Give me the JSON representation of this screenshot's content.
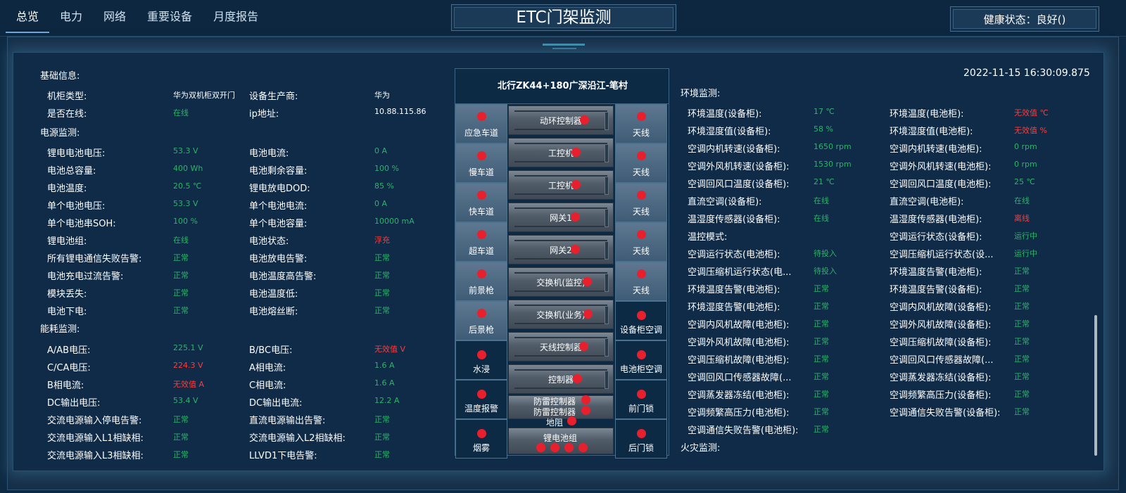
{
  "nav": {
    "tabs": [
      "总览",
      "电力",
      "网络",
      "重要设备",
      "月度报告"
    ]
  },
  "header": {
    "title": "ETC门架监测",
    "health": "健康状态：良好()"
  },
  "datetime": "2022-11-15 16:30:09.875",
  "left": {
    "basic_title": "基础信息:",
    "basic": [
      {
        "l1": "机柜类型:",
        "v1": "华为双机柜双开门",
        "c1": "w",
        "l2": "设备生产商:",
        "v2": "华为",
        "c2": "w"
      },
      {
        "l1": "是否在线:",
        "v1": "在线",
        "c1": "g",
        "l2": "ip地址:",
        "v2": "10.88.115.86",
        "c2": "w"
      }
    ],
    "power_title": "电源监测:",
    "power": [
      {
        "l1": "锂电电池电压:",
        "v1": "53.3 V",
        "c1": "g",
        "l2": "电池电流:",
        "v2": "0 A",
        "c2": "g"
      },
      {
        "l1": "电池总容量:",
        "v1": "400 Wh",
        "c1": "g",
        "l2": "电池剩余容量:",
        "v2": "100 %",
        "c2": "g"
      },
      {
        "l1": "电池温度:",
        "v1": "20.5 ℃",
        "c1": "g",
        "l2": "锂电放电DOD:",
        "v2": "85 %",
        "c2": "g"
      },
      {
        "l1": "单个电池电压:",
        "v1": "53.3 V",
        "c1": "g",
        "l2": "单个电池电流:",
        "v2": "0 A",
        "c2": "g"
      },
      {
        "l1": "单个电池串SOH:",
        "v1": "100 %",
        "c1": "g",
        "l2": "单个电池容量:",
        "v2": "10000 mA",
        "c2": "g"
      },
      {
        "l1": "锂电池组:",
        "v1": "在线",
        "c1": "g",
        "l2": "电池状态:",
        "v2": "浮充",
        "c2": "r"
      },
      {
        "l1": "所有锂电通信失败告警:",
        "v1": "正常",
        "c1": "g",
        "l2": "电池放电告警:",
        "v2": "正常",
        "c2": "g"
      },
      {
        "l1": "电池充电过流告警:",
        "v1": "正常",
        "c1": "g",
        "l2": "电池温度高告警:",
        "v2": "正常",
        "c2": "g"
      },
      {
        "l1": "模块丢失:",
        "v1": "正常",
        "c1": "g",
        "l2": "电池温度低:",
        "v2": "正常",
        "c2": "g"
      },
      {
        "l1": "电池下电:",
        "v1": "正常",
        "c1": "g",
        "l2": "电池熔丝断:",
        "v2": "正常",
        "c2": "g"
      }
    ],
    "energy_title": "能耗监测:",
    "energy": [
      {
        "l1": "A/AB电压:",
        "v1": "225.1 V",
        "c1": "g",
        "l2": "B/BC电压:",
        "v2": "无效值 V",
        "c2": "r"
      },
      {
        "l1": "C/CA电压:",
        "v1": "224.3 V",
        "c1": "r",
        "l2": "A相电流:",
        "v2": "1.6 A",
        "c2": "g"
      },
      {
        "l1": "B相电流:",
        "v1": "无效值 A",
        "c1": "r",
        "l2": "C相电流:",
        "v2": "1.6 A",
        "c2": "g"
      },
      {
        "l1": "DC输出电压:",
        "v1": "53.4 V",
        "c1": "g",
        "l2": "DC输出电流:",
        "v2": "12.2 A",
        "c2": "g"
      },
      {
        "l1": "交流电源输入停电告警:",
        "v1": "正常",
        "c1": "g",
        "l2": "直流电源输出告警:",
        "v2": "正常",
        "c2": "g"
      },
      {
        "l1": "交流电源输入L1相缺相:",
        "v1": "正常",
        "c1": "g",
        "l2": "交流电源输入L2相缺相:",
        "v2": "正常",
        "c2": "g"
      },
      {
        "l1": "交流电源输入L3相缺相:",
        "v1": "正常",
        "c1": "g",
        "l2": "LLVD1下电告警:",
        "v2": "正常",
        "c2": "g"
      }
    ]
  },
  "center": {
    "title": "北行ZK44+180广深沿江-笔村",
    "left_cells": [
      "应急车道",
      "慢车道",
      "快车道",
      "超车道",
      "前景枪",
      "后景枪",
      "水浸",
      "温度报警",
      "烟雾"
    ],
    "right_cells": [
      "天线",
      "天线",
      "天线",
      "天线",
      "天线",
      "设备柜空调",
      "电池柜空调",
      "前门锁",
      "后门锁"
    ],
    "racks": [
      "动环控制器",
      "工控机",
      "工控机",
      "网关1",
      "网关2",
      "交换机(监控)",
      "交换机(业务)",
      "天线控制器",
      "控制器"
    ],
    "stack_labels": [
      "防雷控制器",
      "防雷控制器",
      "地阻",
      "锂电池组"
    ]
  },
  "right": {
    "env_title": "环境监测:",
    "rows": [
      {
        "l1": "环境温度(设备柜):",
        "v1": "17 ℃",
        "c1": "g",
        "l2": "环境温度(电池柜):",
        "v2": "无效值 ℃",
        "c2": "r"
      },
      {
        "l1": "环境湿度值(设备柜):",
        "v1": "58 %",
        "c1": "g",
        "l2": "环境湿度值(电池柜):",
        "v2": "无效值 %",
        "c2": "r"
      },
      {
        "l1": "空调内机转速(设备柜):",
        "v1": "1650 rpm",
        "c1": "g",
        "l2": "空调内机转速(电池柜):",
        "v2": "0 rpm",
        "c2": "g"
      },
      {
        "l1": "空调外风机转速(设备柜):",
        "v1": "1530 rpm",
        "c1": "g",
        "l2": "空调外风机转速(电池柜):",
        "v2": "0 rpm",
        "c2": "g"
      },
      {
        "l1": "空调回风口温度(设备柜):",
        "v1": "21 ℃",
        "c1": "g",
        "l2": "空调回风口温度(电池柜):",
        "v2": "25 ℃",
        "c2": "g"
      },
      {
        "l1": "直流空调(设备柜):",
        "v1": "在线",
        "c1": "g",
        "l2": "直流空调(电池柜):",
        "v2": "在线",
        "c2": "g"
      },
      {
        "l1": "温湿度传感器(设备柜):",
        "v1": "在线",
        "c1": "g",
        "l2": "温湿度传感器(电池柜):",
        "v2": "离线",
        "c2": "r"
      },
      {
        "l1": "温控模式:",
        "v1": "",
        "c1": "g",
        "l2": "空调运行状态(设备柜):",
        "v2": "运行中",
        "c2": "g"
      },
      {
        "l1": "空调运行状态(电池柜):",
        "v1": "待投入",
        "c1": "g",
        "l2": "空调压缩机运行状态(设...",
        "v2": "运行中",
        "c2": "g"
      },
      {
        "l1": "空调压缩机运行状态(电...",
        "v1": "待投入",
        "c1": "g",
        "l2": "环境温度告警(电池柜):",
        "v2": "正常",
        "c2": "g"
      },
      {
        "l1": "环境温度告警(电池柜):",
        "v1": "正常",
        "c1": "g",
        "l2": "环境温度告警(设备柜):",
        "v2": "正常",
        "c2": "g"
      },
      {
        "l1": "环境湿度告警(电池柜):",
        "v1": "正常",
        "c1": "g",
        "l2": "空调内风机故障(设备柜):",
        "v2": "正常",
        "c2": "g"
      },
      {
        "l1": "空调内风机故障(电池柜):",
        "v1": "正常",
        "c1": "g",
        "l2": "空调外风机故障(设备柜):",
        "v2": "正常",
        "c2": "g"
      },
      {
        "l1": "空调外风机故障(电池柜):",
        "v1": "正常",
        "c1": "g",
        "l2": "空调压缩机故障(设备柜):",
        "v2": "正常",
        "c2": "g"
      },
      {
        "l1": "空调压缩机故障(电池柜):",
        "v1": "正常",
        "c1": "g",
        "l2": "空调回风口传感器故障(...",
        "v2": "正常",
        "c2": "g"
      },
      {
        "l1": "空调回风口传感器故障(...",
        "v1": "正常",
        "c1": "g",
        "l2": "空调蒸发器冻结(设备柜):",
        "v2": "正常",
        "c2": "g"
      },
      {
        "l1": "空调蒸发器冻结(电池柜):",
        "v1": "正常",
        "c1": "g",
        "l2": "空调频繁高压力(设备柜):",
        "v2": "正常",
        "c2": "g"
      },
      {
        "l1": "空调频繁高压力(电池柜):",
        "v1": "正常",
        "c1": "g",
        "l2": "空调通信失败告警(设备柜):",
        "v2": "正常",
        "c2": "g"
      },
      {
        "l1": "空调通信失败告警(电池柜):",
        "v1": "正常",
        "c1": "g",
        "l2": "",
        "v2": "",
        "c2": "g"
      }
    ],
    "fire_title": "火灾监测:"
  },
  "colors": {
    "online": "#2fb26a",
    "alarm": "#ff3b3b",
    "dot": "#e8202e",
    "background": "#0e2a44"
  }
}
